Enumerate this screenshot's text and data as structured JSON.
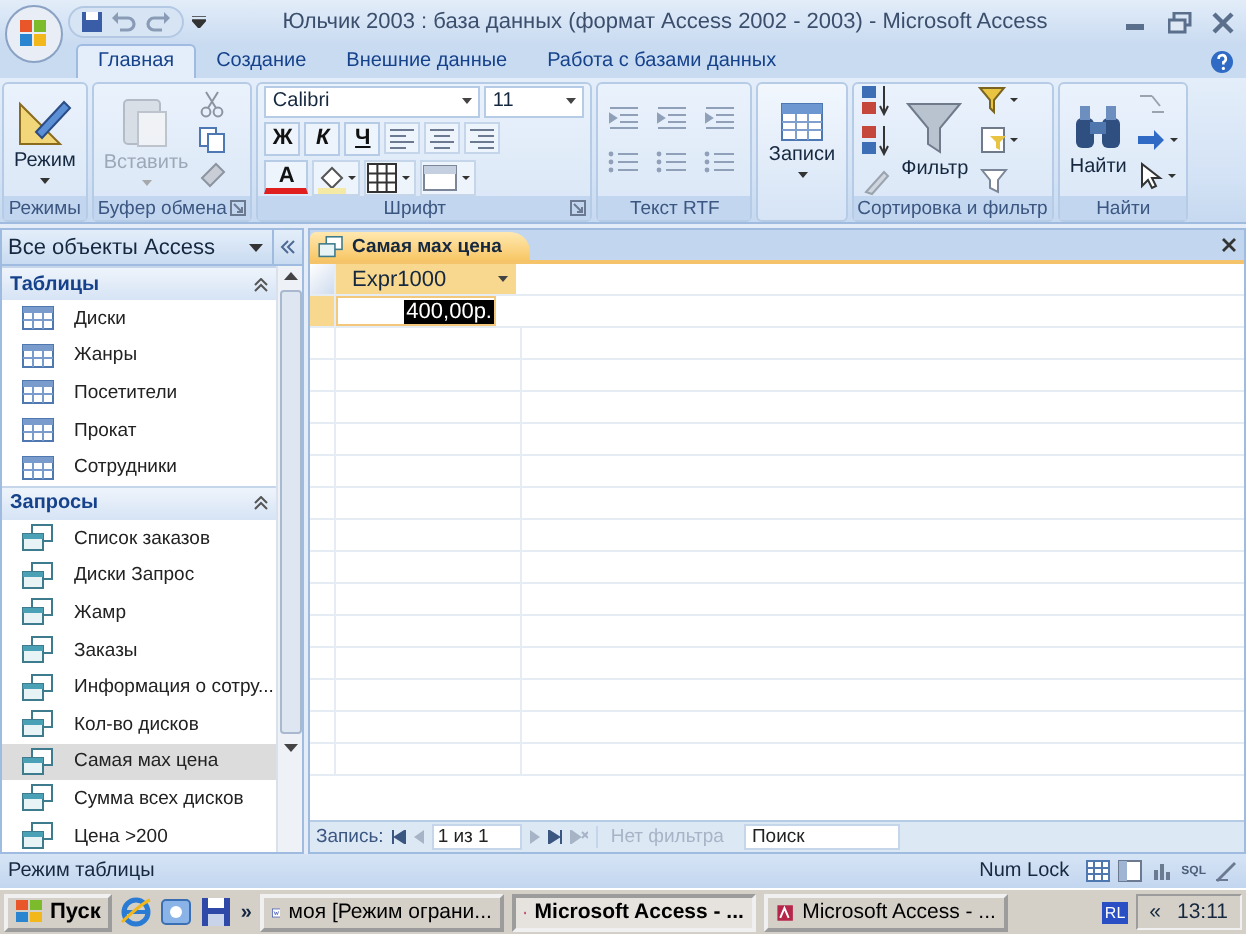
{
  "window": {
    "title": "Юльчик 2003 : база данных (формат Access 2002 - 2003) - Microsoft Access"
  },
  "tabs": [
    {
      "label": "Главная",
      "selected": true
    },
    {
      "label": "Создание",
      "selected": false
    },
    {
      "label": "Внешние данные",
      "selected": false
    },
    {
      "label": "Работа с базами данных",
      "selected": false
    }
  ],
  "ribbon": [
    {
      "kind": "modes",
      "label": "Режимы",
      "button": {
        "label": "Режим",
        "disabled": false
      }
    },
    {
      "kind": "clipboard",
      "label": "Буфер обмена",
      "button": {
        "label": "Вставить",
        "disabled": true
      }
    },
    {
      "kind": "font",
      "label": "Шрифт",
      "font_name": "Calibri",
      "font_size": "11",
      "style_buttons": [
        "Ж",
        "К",
        "Ч"
      ],
      "color_letter": "А"
    },
    {
      "kind": "rtf",
      "label": "Текст RTF"
    },
    {
      "kind": "records",
      "button": {
        "label": "Записи",
        "disabled": false
      }
    },
    {
      "kind": "sort",
      "label": "Сортировка и фильтр",
      "button": {
        "label": "Фильтр",
        "disabled": false
      }
    },
    {
      "kind": "find",
      "label": "Найти",
      "button": {
        "label": "Найти",
        "disabled": false
      }
    }
  ],
  "nav_pane": {
    "title": "Все объекты Access",
    "sections": [
      {
        "title": "Таблицы",
        "kind": "table",
        "items": [
          {
            "label": "Диски",
            "selected": false
          },
          {
            "label": "Жанры",
            "selected": false
          },
          {
            "label": "Посетители",
            "selected": false
          },
          {
            "label": "Прокат",
            "selected": false
          },
          {
            "label": "Сотрудники",
            "selected": false
          }
        ]
      },
      {
        "title": "Запросы",
        "kind": "query",
        "items": [
          {
            "label": "Список заказов",
            "selected": false
          },
          {
            "label": "Диски Запрос",
            "selected": false
          },
          {
            "label": "Жамр",
            "selected": false
          },
          {
            "label": "Заказы",
            "selected": false
          },
          {
            "label": "Информация о сотру...",
            "selected": false
          },
          {
            "label": "Кол-во дисков",
            "selected": false
          },
          {
            "label": "Самая мах цена",
            "selected": true
          },
          {
            "label": "Сумма всех дисков",
            "selected": false
          },
          {
            "label": "Цена >200",
            "selected": false
          }
        ]
      }
    ]
  },
  "document_tab": {
    "label": "Самая мах цена"
  },
  "datasheet": {
    "columns": [
      "Expr1000"
    ],
    "rows": [
      {
        "cells": [
          {
            "value": "400,00р.",
            "selected": true
          }
        ]
      }
    ]
  },
  "record_nav": {
    "label": "Запись:",
    "position": "1 из 1",
    "filter": "Нет фильтра",
    "search_placeholder": "Поиск"
  },
  "status_bar": {
    "mode": "Режим таблицы",
    "num_lock": "Num Lock",
    "view_sql": "SQL"
  },
  "taskbar": {
    "start": "Пуск",
    "more": "»",
    "windows": [
      {
        "label": "моя [Режим ограни...",
        "selected": false
      },
      {
        "label": "Microsoft Access - ...",
        "selected": true
      },
      {
        "label": "Microsoft Access - ...",
        "selected": false
      }
    ],
    "lang": "RL",
    "tray_toggle": "«",
    "clock": "13:11"
  }
}
